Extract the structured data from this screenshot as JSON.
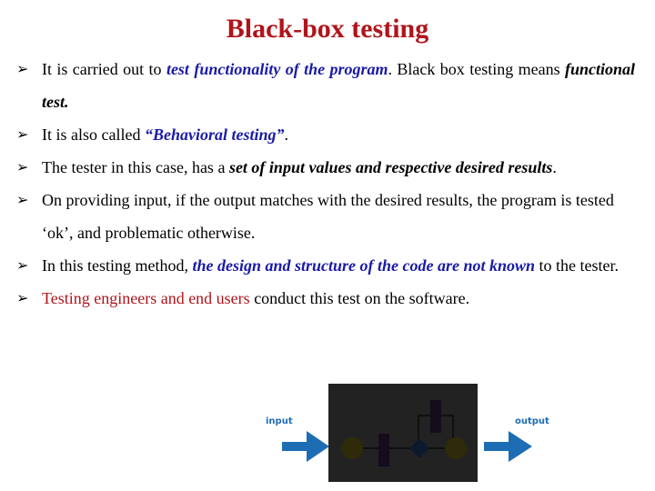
{
  "slide": {
    "title": "Black-box testing",
    "bullets": [
      {
        "parts": [
          {
            "text": "It is carried out to ",
            "style": "plain"
          },
          {
            "text": "test functionality of the program",
            "style": "em-blue"
          },
          {
            "text": ". Black box testing means ",
            "style": "plain"
          },
          {
            "text": "functional test.",
            "style": "em-black"
          }
        ]
      },
      {
        "parts": [
          {
            "text": "It is also called ",
            "style": "plain"
          },
          {
            "text": "“Behavioral testing”",
            "style": "em-blue"
          },
          {
            "text": ".",
            "style": "plain"
          }
        ]
      },
      {
        "parts": [
          {
            "text": "The tester in this case, has a ",
            "style": "plain"
          },
          {
            "text": "set of input values and respective desired results",
            "style": "em-black"
          },
          {
            "text": ".",
            "style": "plain"
          }
        ]
      },
      {
        "parts": [
          {
            "text": "On providing input, if the output matches with the desired results, the program is tested ‘ok’, and problematic otherwise.",
            "style": "plain"
          }
        ]
      },
      {
        "parts": [
          {
            "text": "In this testing method, ",
            "style": "plain"
          },
          {
            "text": "the design and structure of the code are not known",
            "style": "em-blue"
          },
          {
            "text": " to the tester.",
            "style": "plain"
          }
        ]
      },
      {
        "parts": [
          {
            "text": "Testing engineers and end users",
            "style": "red"
          },
          {
            "text": " conduct this test on the software.",
            "style": "plain"
          }
        ]
      }
    ],
    "bullet_icon": "arrowhead-bullet-icon",
    "bullet_glyph": "➢"
  },
  "diagram": {
    "input_label": "input",
    "output_label": "output",
    "colors": {
      "arrow": "#1d6db5",
      "box": "#222222",
      "circle": "#2e2a0a",
      "rect": "#150c1c",
      "diamond": "#0d1a2e"
    }
  }
}
